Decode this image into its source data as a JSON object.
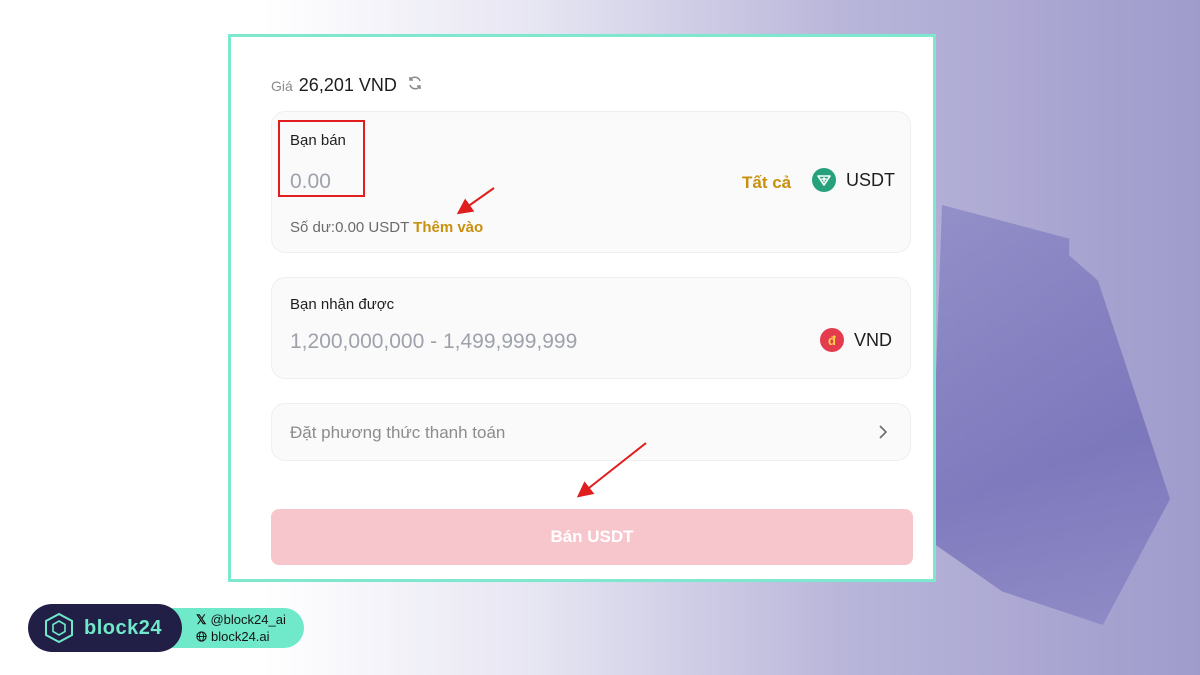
{
  "price": {
    "label": "Giá",
    "value": "26,201 VND",
    "icon": "refresh-icon"
  },
  "sell": {
    "label": "Bạn bán",
    "amount_placeholder": "0.00",
    "all_link": "Tất cả",
    "currency": "USDT",
    "currency_icon": "tether-icon",
    "balance_text": "Số dư:0.00 USDT",
    "add_link": "Thêm vào"
  },
  "receive": {
    "label": "Bạn nhận được",
    "range": "1,200,000,000 - 1,499,999,999",
    "currency": "VND",
    "currency_symbol": "đ",
    "currency_icon": "dong-icon"
  },
  "payment": {
    "label": "Đặt phương thức thanh toán",
    "icon": "chevron-right-icon"
  },
  "submit": {
    "label": "Bán USDT"
  },
  "branding": {
    "name": "block24",
    "twitter": "@block24_ai",
    "website": "block24.ai"
  },
  "colors": {
    "accent_gold": "#c8900e",
    "button_disabled": "#f7c6cc",
    "card_border": "#7ee8cf",
    "annotation_red": "#e01e1e",
    "brand_dark": "#221f47",
    "brand_mint": "#6fe9c9"
  }
}
